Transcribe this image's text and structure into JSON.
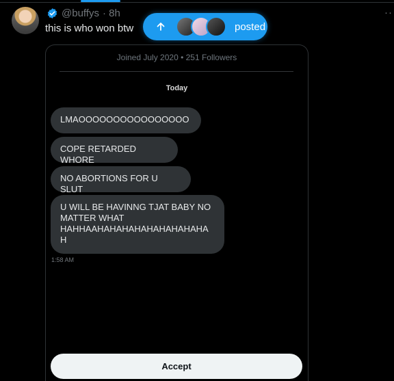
{
  "tweet": {
    "handle": "@buffys",
    "time": "· 8h",
    "text": "this is who won btw",
    "more": "··"
  },
  "posted_pill": {
    "label": "posted"
  },
  "dm": {
    "joined": "Joined July 2020 • 251 Followers",
    "day": "Today",
    "messages": [
      "LMAOOOOOOOOOOOOOOOO",
      "COPE RETARDED WHORE",
      "NO ABORTIONS FOR U SLUT",
      "U WILL BE HAVINNG TJAT BABY NO\nMATTER WHAT\nHAHHAAHAHAHAHAHAHAHAHAHA\nH"
    ],
    "timestamp": "1:58 AM",
    "accept_label": "Accept"
  }
}
